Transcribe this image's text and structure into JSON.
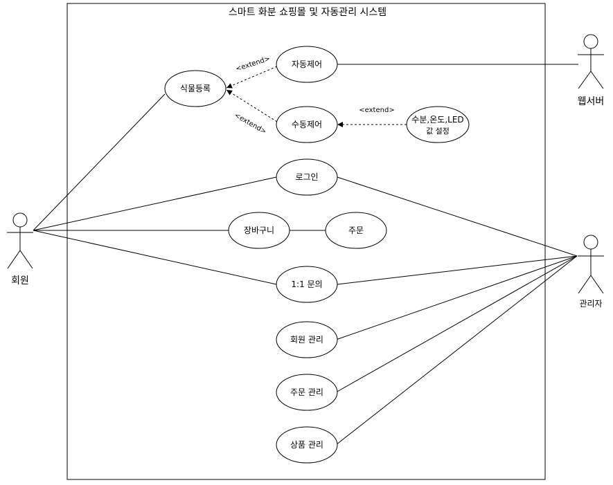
{
  "system": {
    "title": "스마트 화분 쇼핑몰 및 자동관리 시스템"
  },
  "actors": {
    "member": "회원",
    "webserver": "웹서버",
    "admin": "관리자"
  },
  "use_cases": {
    "plant_register": "식물등록",
    "auto_control": "자동제어",
    "manual_control": "수동제어",
    "setting_line1": "수분,온도,LED",
    "setting_line2": "값 설정",
    "login": "로그인",
    "cart": "장바구니",
    "order": "주문",
    "inquiry": "1:1 문의",
    "member_mgmt": "회원 관리",
    "order_mgmt": "주문 관리",
    "product_mgmt": "상품 관리"
  },
  "relations": {
    "extend_auto": "<extend>",
    "extend_manual": "<extend>",
    "extend_setting": "<extend>"
  }
}
